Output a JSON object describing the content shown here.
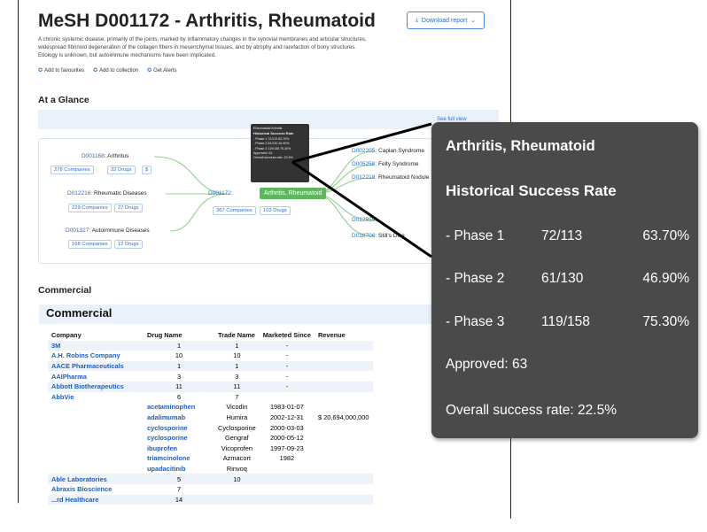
{
  "page": {
    "title": "MeSH D001172 - Arthritis, Rheumatoid",
    "download_label": "Download report",
    "description": "A chronic systemic disease, primarily of the joints, marked by inflammatory changes in the synovial membranes and articular structures, widespread fibrinoid degeneration of the collagen fibers in mesenchymal tissues, and by atrophy and rarefaction of bony structures. Etiology is unknown, but autoimmune mechanisms have been implicated.",
    "actions": [
      "Add to favourites",
      "Add to collection",
      "Get Alerts"
    ]
  },
  "glance": {
    "heading": "At a Glance",
    "see_full": "See full view",
    "left_nodes": [
      {
        "code": "D001168:",
        "name": "Arthritus",
        "companies": "278 Companies",
        "drugs": "32 Drugs",
        "extra": "$"
      },
      {
        "code": "D012216:",
        "name": "Rheumatic Diseases",
        "companies": "229 Companies",
        "drugs": "27 Drugs"
      },
      {
        "code": "D001327:",
        "name": "Autoimmune Diseases",
        "companies": "168 Companies",
        "drugs": "12 Drugs"
      }
    ],
    "center": {
      "code": "D001172:",
      "name": "Arthritis, Rheumatoid",
      "companies": "367 Companies",
      "drugs": "103 Drugs"
    },
    "right_nodes": [
      {
        "code": "D002205:",
        "name": "Caplan Syndrome"
      },
      {
        "code": "D005258:",
        "name": "Felty Syndrome"
      },
      {
        "code": "D012218:",
        "name": "Rheumatoid Nodule"
      },
      {
        "code": "D012859:",
        "name": ""
      },
      {
        "code": "D016706:",
        "name": "Still's Dise"
      }
    ],
    "mini_tooltip": {
      "title": "Rheumatoid Arthritis",
      "heading": "Historical Success Rate",
      "rows": [
        "- Phase 1   72/113   63.70%",
        "- Phase 2   61/130   46.90%",
        "- Phase 3   119/158   75.30%"
      ],
      "approved": "Approved: 63",
      "overall": "Overall success rate: 22.5%"
    }
  },
  "commercial": {
    "heading": "Commercial",
    "panel_title": "Commercial",
    "columns": [
      "Company",
      "Drug Name",
      "Trade Name",
      "Marketed Since",
      "Revenue"
    ],
    "rows": [
      {
        "company": "3M",
        "drug": "1",
        "trade": "1",
        "since": "-",
        "revenue": "",
        "shade": true
      },
      {
        "company": "A.H. Robins Company",
        "drug": "10",
        "trade": "10",
        "since": "-",
        "revenue": "",
        "shade": false
      },
      {
        "company": "AACE Pharmaceuticals",
        "drug": "1",
        "trade": "1",
        "since": "-",
        "revenue": "",
        "shade": true
      },
      {
        "company": "AAIPharma",
        "drug": "3",
        "trade": "3",
        "since": "-",
        "revenue": "",
        "shade": false
      },
      {
        "company": "Abbott Biotherapeutics",
        "drug": "11",
        "trade": "11",
        "since": "-",
        "revenue": "",
        "shade": true
      },
      {
        "company": "AbbVie",
        "drug": "6",
        "trade": "7",
        "since": "",
        "revenue": "",
        "shade": false
      },
      {
        "company": "",
        "drug": "acetaminophen",
        "trade": "Vicodin",
        "since": "1983-01-07",
        "revenue": "",
        "shade": false,
        "drugLink": true
      },
      {
        "company": "",
        "drug": "adalimumab",
        "trade": "Humira",
        "since": "2002-12-31",
        "revenue": "$      20,694,000,000",
        "shade": false,
        "drugLink": true
      },
      {
        "company": "",
        "drug": "cyclosporine",
        "trade": "Cyclosporine",
        "since": "2000-03-03",
        "revenue": "",
        "shade": false,
        "drugLink": true
      },
      {
        "company": "",
        "drug": "cyclosporine",
        "trade": "Gengraf",
        "since": "2000-05-12",
        "revenue": "",
        "shade": false,
        "drugLink": true
      },
      {
        "company": "",
        "drug": "ibuprofen",
        "trade": "Vicoprofen",
        "since": "1997-09-23",
        "revenue": "",
        "shade": false,
        "drugLink": true
      },
      {
        "company": "",
        "drug": "triamcinolone",
        "trade": "Azmacort",
        "since": "1982",
        "revenue": "",
        "shade": false,
        "drugLink": true
      },
      {
        "company": "",
        "drug": "upadacitinib",
        "trade": "Rinvoq",
        "since": "",
        "revenue": "",
        "shade": false,
        "drugLink": true
      },
      {
        "company": "Able Laboratories",
        "drug": "5",
        "trade": "10",
        "since": "",
        "revenue": "",
        "shade": true
      },
      {
        "company": "Abraxis Bioscience",
        "drug": "7",
        "trade": "",
        "since": "",
        "revenue": "",
        "shade": false
      },
      {
        "company": "...rd Healthcare",
        "drug": "14",
        "trade": "",
        "since": "",
        "revenue": "",
        "shade": true
      }
    ]
  },
  "tooltip": {
    "title": "Arthritis, Rheumatoid",
    "heading": "Historical Success Rate",
    "phases": [
      {
        "name": "- Phase 1",
        "count": "72/113",
        "pct": "63.70%"
      },
      {
        "name": "- Phase 2",
        "count": "61/130",
        "pct": "46.90%"
      },
      {
        "name": "- Phase 3",
        "count": "119/158",
        "pct": "75.30%"
      }
    ],
    "approved": "Approved: 63",
    "overall": "Overall success rate: 22.5%"
  },
  "colors": {
    "accent": "#2a6fc9",
    "center_node": "#5cb85c",
    "tooltip_bg": "#4a4a4a"
  }
}
